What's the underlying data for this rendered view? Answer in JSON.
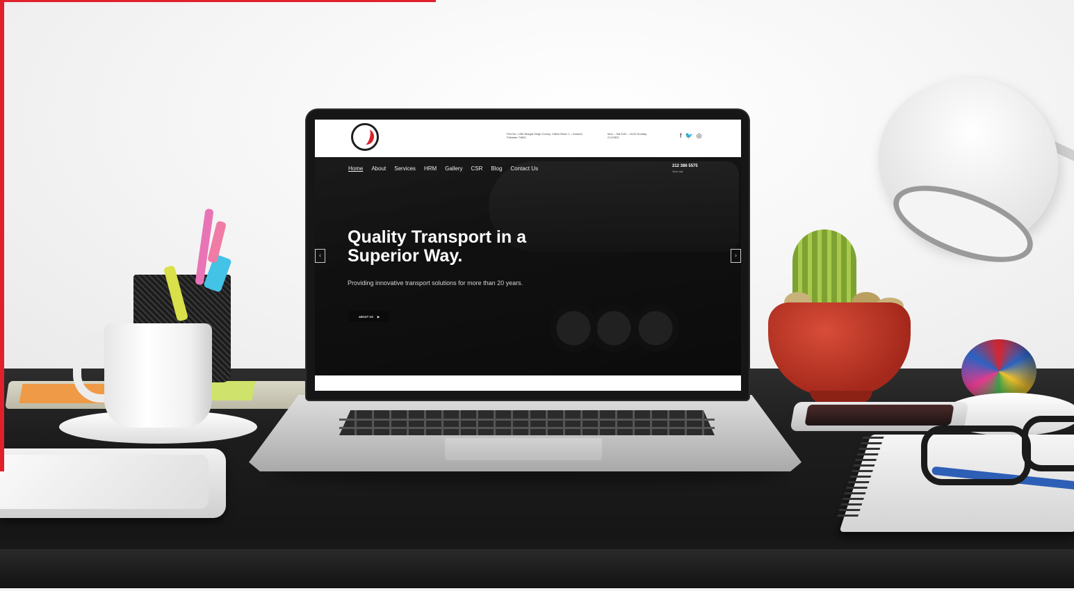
{
  "colors": {
    "accent": "#e0202a",
    "site_topbar": "#ffffff",
    "site_hero": "#1a1a1a",
    "cactus_pot": "#b3301f"
  },
  "website": {
    "logo_icon": "red-swoosh-logo-icon",
    "header": {
      "address": "Plot No. L/38/ Bhagat Singh Colony, Clifton Block 1 – Karachi, Pakistan 74600",
      "hours": "Mon – Sat 8:00 – 18:00 Sunday CLOSED",
      "social_icons": [
        "facebook-icon",
        "twitter-icon",
        "instagram-icon"
      ],
      "social_glyphs": [
        "f",
        "🐦",
        "◎"
      ]
    },
    "nav": {
      "items": [
        "Home",
        "About",
        "Services",
        "HRM",
        "Gallery",
        "CSR",
        "Blog",
        "Contact Us"
      ],
      "active": "Home",
      "phone": "212 386 5575",
      "phone_sub": "Give call"
    },
    "hero": {
      "title": "Quality Transport in a Superior Way.",
      "text": "Providing innovative transport solutions for more than 20 years.",
      "button_label": "ABOUT US",
      "button_icon": "play-arrow-icon",
      "prev_icon": "chevron-left-icon",
      "next_icon": "chevron-right-icon"
    }
  }
}
